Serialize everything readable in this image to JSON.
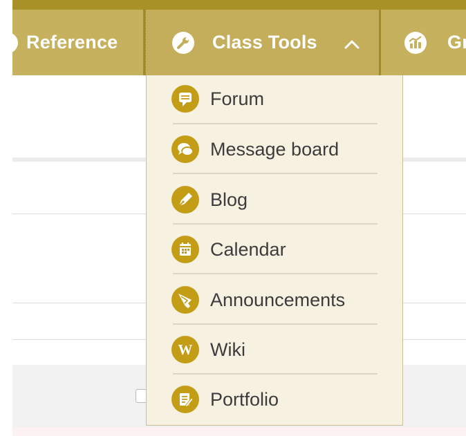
{
  "nav": {
    "reference_label": "Reference",
    "class_tools_label": "Class Tools",
    "grades_label": "Gr"
  },
  "menu": {
    "items": [
      {
        "label": "Forum",
        "icon": "forum-icon"
      },
      {
        "label": "Message board",
        "icon": "message-board-icon"
      },
      {
        "label": "Blog",
        "icon": "blog-icon"
      },
      {
        "label": "Calendar",
        "icon": "calendar-icon"
      },
      {
        "label": "Announcements",
        "icon": "announcements-icon"
      },
      {
        "label": "Wiki",
        "icon": "wiki-icon"
      },
      {
        "label": "Portfolio",
        "icon": "portfolio-icon"
      }
    ]
  },
  "colors": {
    "nav_bar": "#c6b15f",
    "accent_strip": "#a89227",
    "dropdown_bg": "#f7f1e2",
    "icon_gold": "#c39d16",
    "text": "#3c3c3c"
  }
}
